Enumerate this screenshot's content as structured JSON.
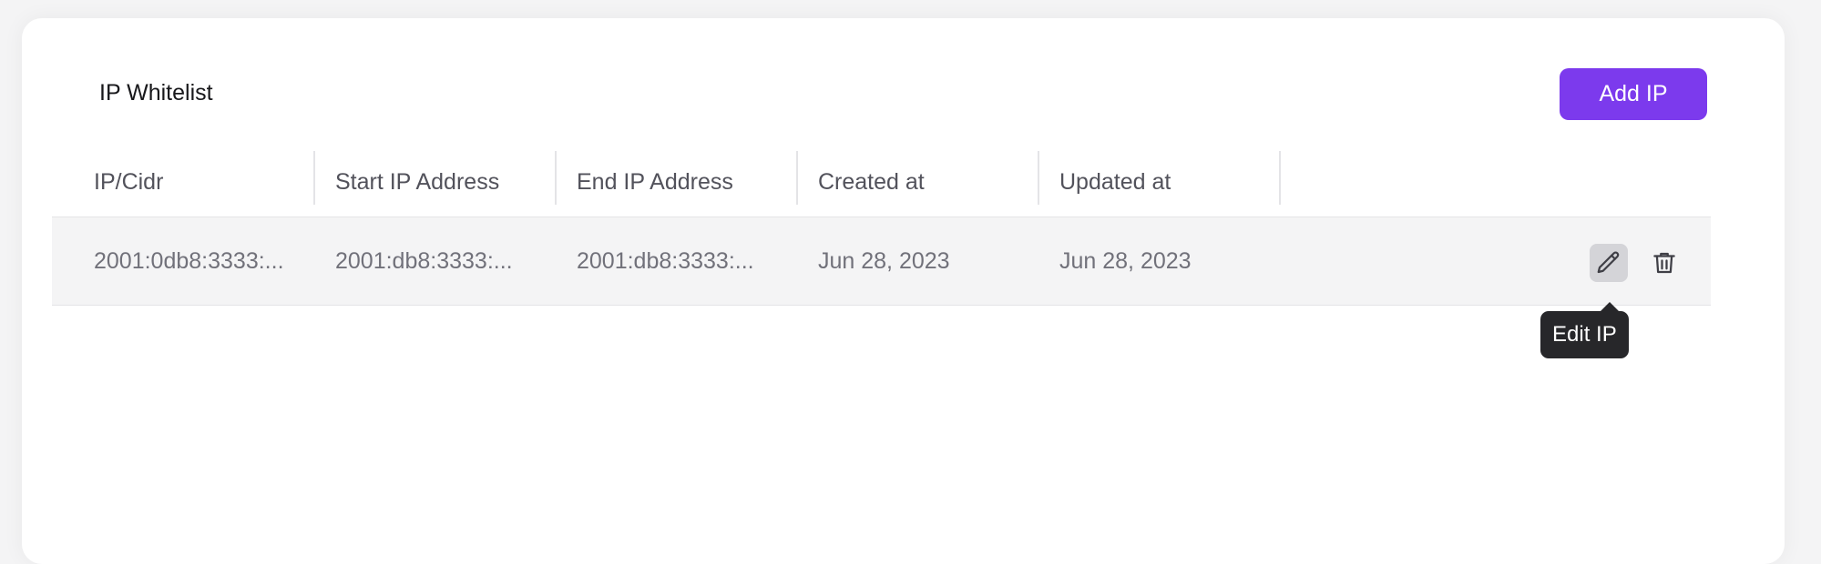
{
  "card": {
    "title": "IP Whitelist",
    "add_button_label": "Add IP"
  },
  "table": {
    "columns": [
      "IP/Cidr",
      "Start IP Address",
      "End IP Address",
      "Created at",
      "Updated at"
    ],
    "rows": [
      {
        "ip_cidr": "2001:0db8:3333:...",
        "start_ip": "2001:db8:3333:...",
        "end_ip": "2001:db8:3333:...",
        "created_at": "Jun 28, 2023",
        "updated_at": "Jun 28, 2023",
        "actions": [
          "pencil-icon",
          "trash-icon"
        ]
      }
    ]
  },
  "tooltip": {
    "text": "Edit IP"
  },
  "colors": {
    "accent": "#7c3aed",
    "tooltip_bg": "#27272a",
    "row_bg": "#f4f4f5"
  }
}
